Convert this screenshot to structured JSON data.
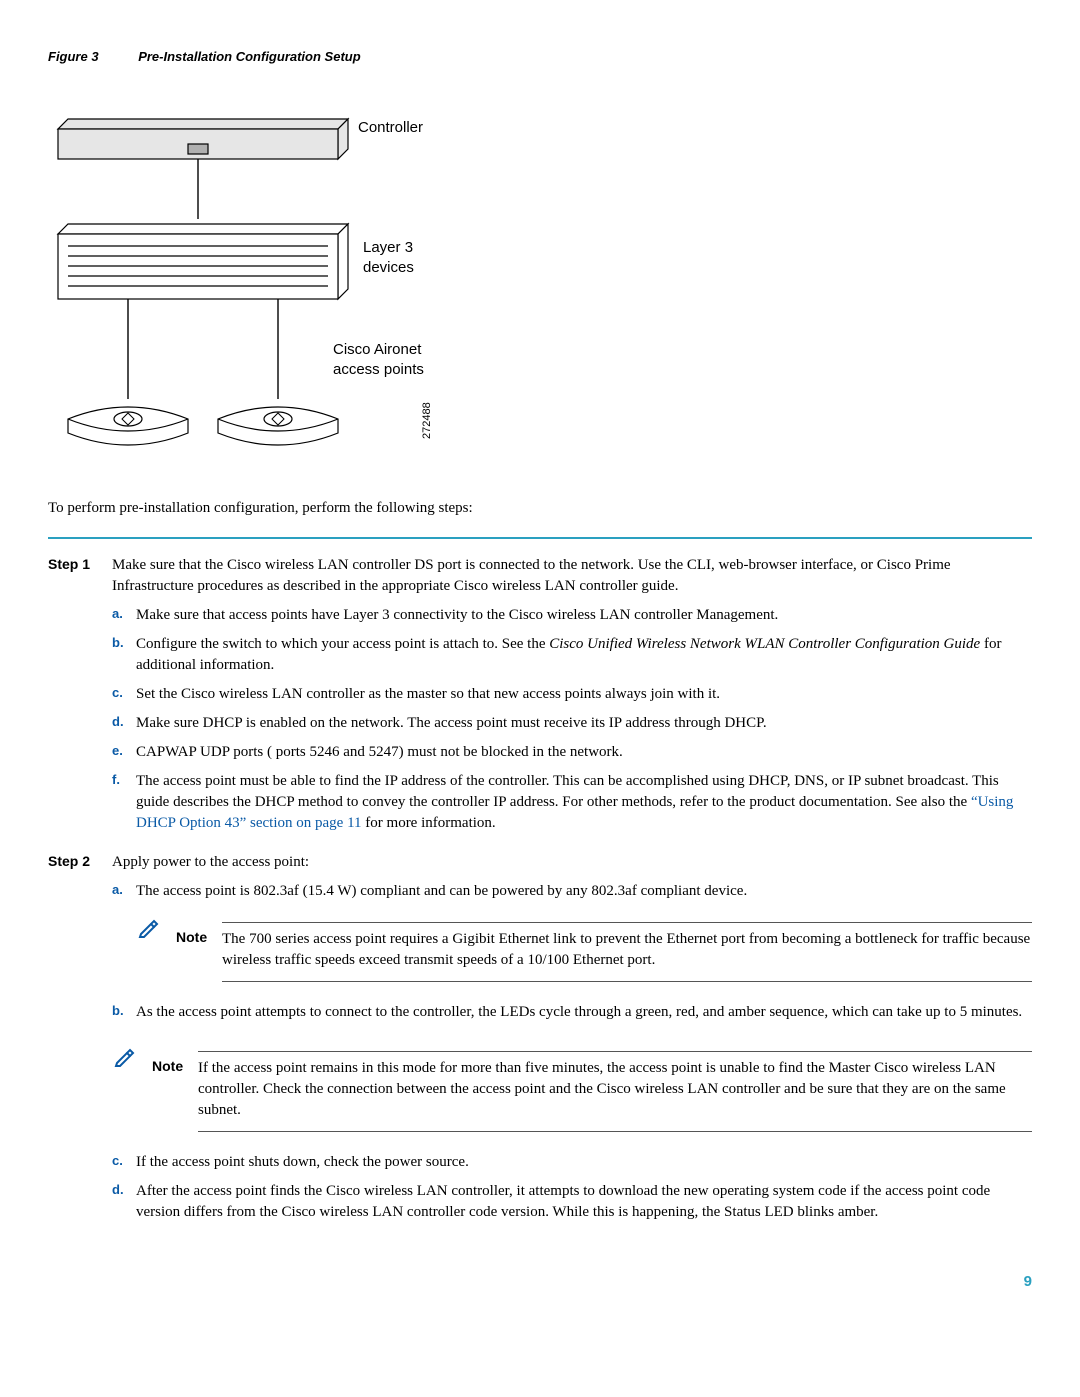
{
  "figure": {
    "label": "Figure 3",
    "title": "Pre-Installation Configuration Setup",
    "controller_label": "Controller",
    "layer3_label_l1": "Layer 3",
    "layer3_label_l2": "devices",
    "ap_label_l1": "Cisco Aironet",
    "ap_label_l2": "access points",
    "ref_num": "272488"
  },
  "intro": "To perform pre-installation configuration, perform the following steps:",
  "step1": {
    "label": "Step 1",
    "body": "Make sure that the Cisco wireless LAN controller DS port is connected to the network. Use the CLI, web-browser interface, or Cisco Prime Infrastructure procedures as described in the appropriate Cisco wireless LAN controller guide.",
    "items": {
      "a": "Make sure that access points have Layer 3 connectivity to the Cisco wireless LAN controller Management.",
      "b_pre": "Configure the switch to which your access point is attach to. See the ",
      "b_em": "Cisco Unified Wireless Network WLAN Controller Configuration Guide",
      "b_post": " for additional information.",
      "c": "Set the Cisco wireless LAN controller as the master so that new access points always join with it.",
      "d": "Make sure DHCP is enabled on the network. The access point must receive its IP address through DHCP.",
      "e": "CAPWAP UDP ports ( ports 5246 and 5247) must not be blocked in the network.",
      "f_pre": "The access point must be able to find the IP address of the controller. This can be accomplished using DHCP, DNS, or IP subnet broadcast. This guide describes the DHCP method to convey the controller IP address. For other methods, refer to the product documentation. See also the ",
      "f_link": "“Using DHCP Option 43” section on page 11",
      "f_post": " for more information."
    }
  },
  "step2": {
    "label": "Step 2",
    "body": "Apply power to the access point:",
    "items": {
      "a": "The access point is 802.3af (15.4 W) compliant and can be powered by any 802.3af compliant device.",
      "b": "As the access point attempts to connect to the controller, the LEDs cycle through a green, red, and amber sequence, which can take up to 5 minutes.",
      "c": "If the access point shuts down, check the power source.",
      "d": "After the access point finds the Cisco wireless LAN controller, it attempts to download the new operating system code if the access point code version differs from the Cisco wireless LAN controller code version. While this is happening, the Status LED blinks amber."
    }
  },
  "note1": {
    "label": "Note",
    "text": "The 700 series access point requires a Gigibit Ethernet link to prevent the Ethernet port from becoming a bottleneck for traffic because wireless traffic speeds exceed transmit speeds of a 10/100 Ethernet port."
  },
  "note2": {
    "label": "Note",
    "text": "If the access point remains in this mode for more than five minutes, the access point is unable to find the Master Cisco wireless LAN controller. Check the connection between the access point and the Cisco wireless LAN controller and be sure that they are on the same subnet."
  },
  "markers": {
    "a": "a.",
    "b": "b.",
    "c": "c.",
    "d": "d.",
    "e": "e.",
    "f": "f."
  },
  "page_number": "9"
}
